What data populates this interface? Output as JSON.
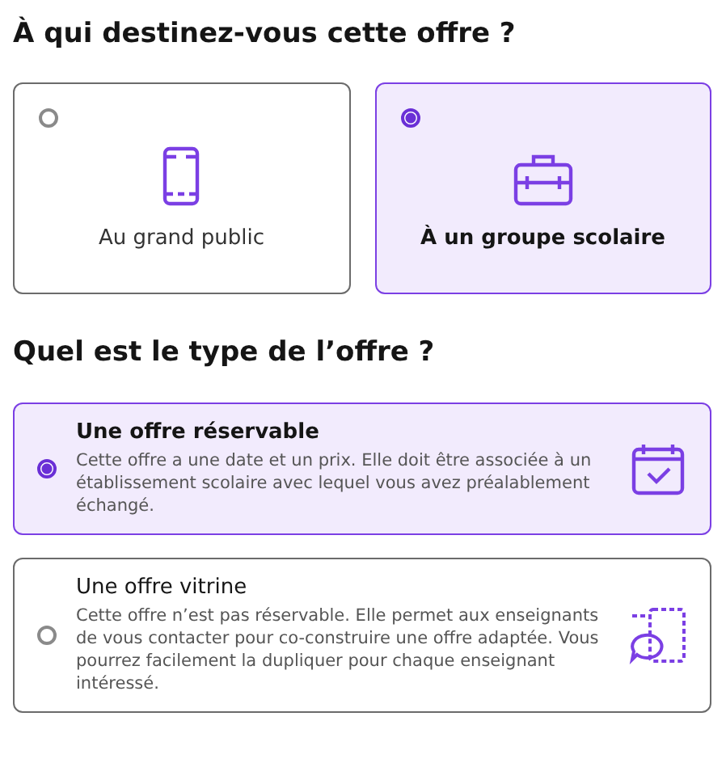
{
  "audience": {
    "title": "À qui destinez-vous cette offre ?",
    "options": [
      {
        "label": "Au grand public",
        "kind": "phone",
        "selected": false
      },
      {
        "label": "À un groupe scolaire",
        "kind": "briefcase",
        "selected": true
      }
    ]
  },
  "offer_type": {
    "title": "Quel est le type de l’offre ?",
    "options": [
      {
        "label": "Une offre réservable",
        "description": "Cette offre a une date et un prix. Elle doit être associée à un établissement scolaire avec lequel vous avez préalablement échangé.",
        "kind": "calendar",
        "selected": true
      },
      {
        "label": "Une offre vitrine",
        "description": "Cette offre n’est pas réservable. Elle permet aux enseignants de vous contacter pour co-construire une offre adaptée. Vous pourrez facilement la dupliquer pour chaque enseignant intéressé.",
        "kind": "chat",
        "selected": false
      }
    ]
  }
}
